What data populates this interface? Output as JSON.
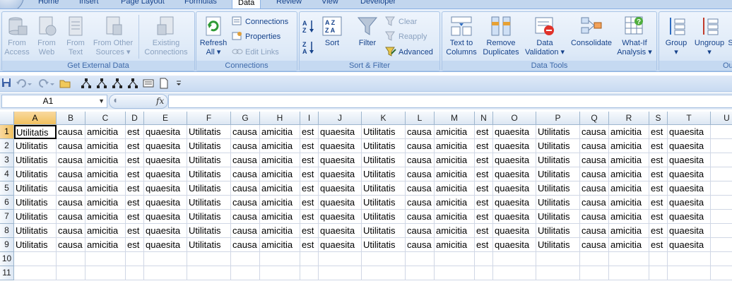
{
  "ribbon_tabs": [
    "Home",
    "Insert",
    "Page Layout",
    "Formulas",
    "Data",
    "Review",
    "View",
    "Developer"
  ],
  "active_tab": "Data",
  "groups": {
    "get_external_data": {
      "label": "Get External Data",
      "buttons": [
        {
          "line1": "From",
          "line2": "Access"
        },
        {
          "line1": "From",
          "line2": "Web"
        },
        {
          "line1": "From",
          "line2": "Text"
        },
        {
          "line1": "From Other",
          "line2": "Sources ▾"
        },
        {
          "line1": "Existing",
          "line2": "Connections"
        }
      ]
    },
    "connections": {
      "label": "Connections",
      "refresh": {
        "line1": "Refresh",
        "line2": "All ▾"
      },
      "connections": "Connections",
      "properties": "Properties",
      "edit_links": "Edit Links"
    },
    "sort_filter": {
      "label": "Sort & Filter",
      "sort": "Sort",
      "filter": "Filter",
      "clear": "Clear",
      "reapply": "Reapply",
      "advanced": "Advanced"
    },
    "data_tools": {
      "label": "Data Tools",
      "buttons": [
        {
          "line1": "Text to",
          "line2": "Columns"
        },
        {
          "line1": "Remove",
          "line2": "Duplicates"
        },
        {
          "line1": "Data",
          "line2": "Validation ▾"
        },
        {
          "line1": "Consolidate",
          "line2": ""
        },
        {
          "line1": "What-If",
          "line2": "Analysis ▾"
        }
      ]
    },
    "outline": {
      "label": "Ou",
      "group": {
        "line1": "Group",
        "line2": "▾"
      },
      "ungroup": {
        "line1": "Ungroup",
        "line2": "▾"
      },
      "subtotal": {
        "line1": "S",
        "line2": ""
      }
    }
  },
  "name_box": "A1",
  "fx_label": "fx",
  "columns": [
    "A",
    "B",
    "C",
    "D",
    "E",
    "F",
    "G",
    "H",
    "I",
    "J",
    "K",
    "L",
    "M",
    "N",
    "O",
    "P",
    "Q",
    "R",
    "S",
    "T",
    "U"
  ],
  "rows": [
    "1",
    "2",
    "3",
    "4",
    "5",
    "6",
    "7",
    "8",
    "9",
    "10",
    "11"
  ],
  "row_values": [
    "Utilitatis",
    "causa",
    "amicitia",
    "est",
    "quaesita",
    "Utilitatis",
    "causa",
    "amicitia",
    "est",
    "quaesita",
    "Utilitatis",
    "causa",
    "amicitia",
    "est",
    "quaesita",
    "Utilitatis",
    "causa",
    "amicitia",
    "est",
    "quaesita",
    ""
  ],
  "filled_rows": 9,
  "active_cell": "A1",
  "colors": {
    "accent": "#15428b",
    "selected_header": "#f1c15f",
    "gridline": "#d0d7e5"
  }
}
